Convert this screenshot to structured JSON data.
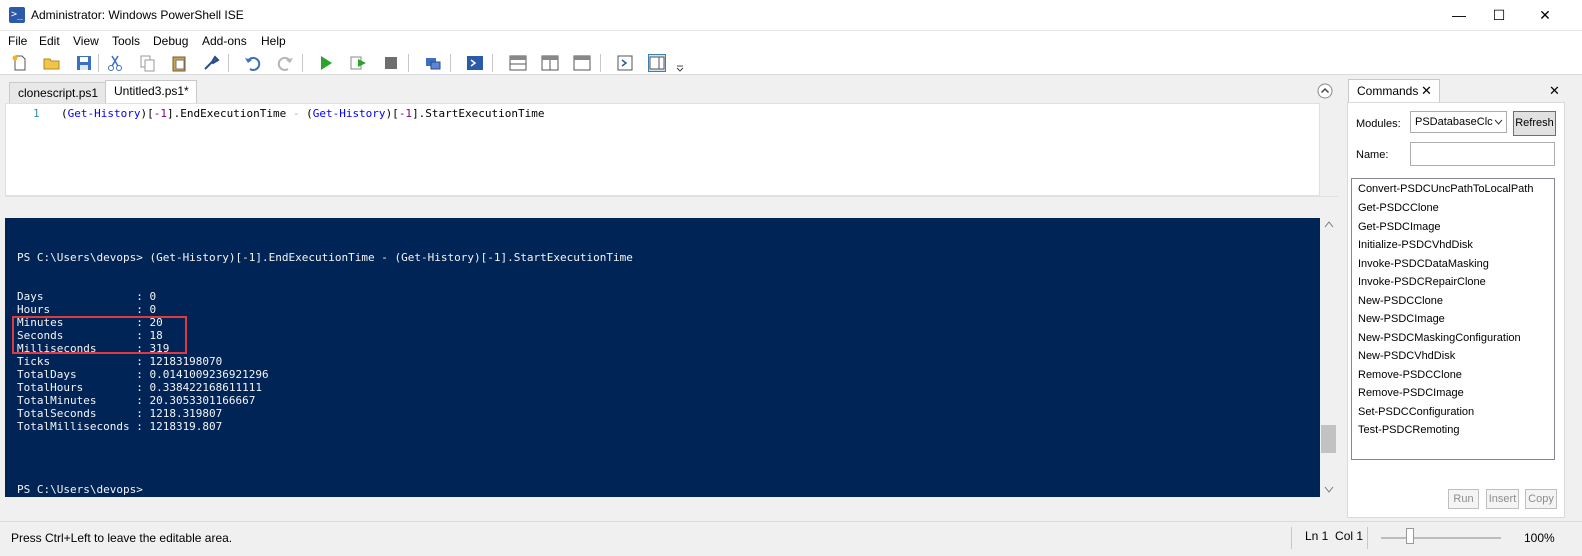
{
  "window": {
    "title": "Administrator: Windows PowerShell ISE",
    "app_icon_glyph": ">_",
    "minimize_glyph": "—",
    "maximize_glyph": "☐",
    "close_glyph": "✕"
  },
  "menu": [
    "File",
    "Edit",
    "View",
    "Tools",
    "Debug",
    "Add-ons",
    "Help"
  ],
  "script_tabs": [
    {
      "label": "clonescript.ps1",
      "active": false
    },
    {
      "label": "Untitled3.ps1*",
      "active": true
    }
  ],
  "editor": {
    "line_number": "1",
    "code": {
      "p1": "(",
      "cmd1": "Get-History",
      "p2": ")[",
      "n1": "-1",
      "p3": "].EndExecutionTime ",
      "op": "-",
      "p4": " (",
      "cmd2": "Get-History",
      "p5": ")[",
      "n2": "-1",
      "p6": "].StartExecutionTime"
    }
  },
  "console": {
    "prompt_command": "PS C:\\Users\\devops> (Get-History)[-1].EndExecutionTime - (Get-History)[-1].StartExecutionTime",
    "output": [
      "Days              : 0",
      "Hours             : 0",
      "Minutes           : 20",
      "Seconds           : 18",
      "Milliseconds      : 319",
      "Ticks             : 12183198070",
      "TotalDays         : 0.0141009236921296",
      "TotalHours        : 0.338422168611111",
      "TotalMinutes      : 20.3053301166667",
      "TotalSeconds      : 1218.319807",
      "TotalMilliseconds : 1218319.807"
    ],
    "final_prompt": "PS C:\\Users\\devops>"
  },
  "commands_pane": {
    "tab_label": "Commands",
    "modules_label": "Modules:",
    "modules_value": "PSDatabaseClc",
    "refresh_label": "Refresh",
    "name_label": "Name:",
    "name_value": "",
    "commands": [
      "Convert-PSDCUncPathToLocalPath",
      "Get-PSDCClone",
      "Get-PSDCImage",
      "Initialize-PSDCVhdDisk",
      "Invoke-PSDCDataMasking",
      "Invoke-PSDCRepairClone",
      "New-PSDCClone",
      "New-PSDCImage",
      "New-PSDCMaskingConfiguration",
      "New-PSDCVhdDisk",
      "Remove-PSDCClone",
      "Remove-PSDCImage",
      "Set-PSDCConfiguration",
      "Test-PSDCRemoting"
    ],
    "run_label": "Run",
    "insert_label": "Insert",
    "copy_label": "Copy"
  },
  "status": {
    "message": "Press Ctrl+Left to leave the editable area.",
    "position": "Ln 1  Col 1",
    "zoom": "100%",
    "zoom_level_percent": 100
  },
  "colors": {
    "console_bg": "#012456",
    "highlight_box": "#e0393e",
    "cmdlet_blue": "#0000ff"
  }
}
